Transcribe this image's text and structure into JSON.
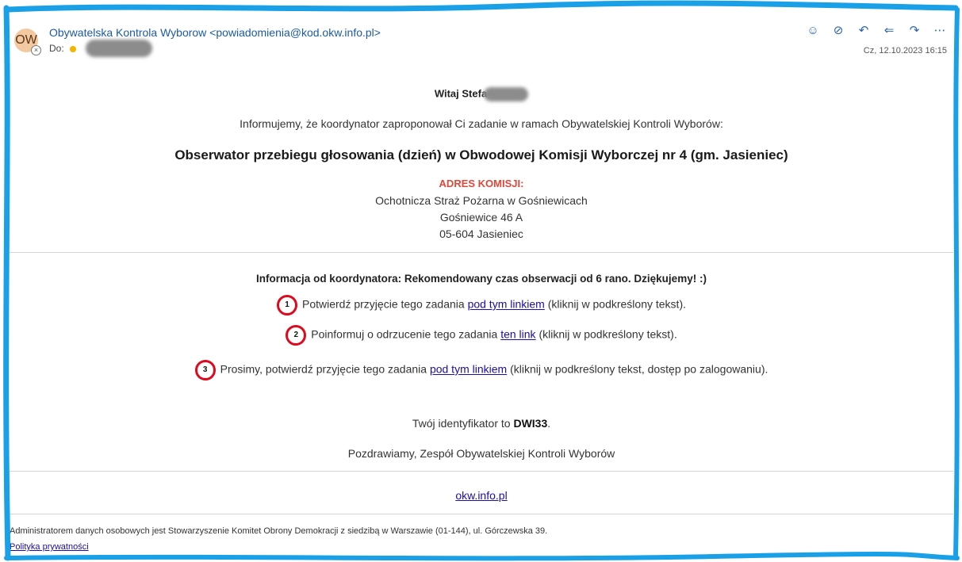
{
  "header": {
    "avatar_initials": "OW",
    "sender": "Obywatelska Kontrola Wyborow <powiadomienia@kod.okw.info.pl>",
    "to_label": "Do:",
    "date": "Cz, 12.10.2023 16:15",
    "toolbar_icons": [
      "emoji-icon",
      "block-icon",
      "reply-icon",
      "reply-all-icon",
      "forward-icon",
      "more-icon"
    ]
  },
  "body": {
    "greeting": "Witaj Stefa",
    "intro": "Informujemy, że koordynator zaproponował Ci zadanie w ramach Obywatelskiej Kontroli Wyborów:",
    "task_title": "Obserwator przebiegu głosowania (dzień) w Obwodowej Komisji Wyborczej nr 4 (gm. Jasieniec)",
    "address_label": "ADRES KOMISJI:",
    "address_lines": [
      "Ochotnicza Straż Pożarna w Gośniewicach",
      "Gośniewice 46 A",
      "05-604 Jasieniec"
    ],
    "coordinator_info": "Informacja od koordynatora: Rekomendowany czas obserwacji od 6 rano. Dziękujemy! :)",
    "actions": [
      {
        "number": "1",
        "before": "Potwierdź przyjęcie tego zadania ",
        "link": "pod tym linkiem",
        "after": " (kliknij w podkreślony tekst)."
      },
      {
        "number": "2",
        "before": "Poinformuj o odrzucenie tego zadania ",
        "link": "ten link",
        "after": " (kliknij w podkreślony tekst)."
      },
      {
        "number": "3",
        "before": "Prosimy, potwierdź przyjęcie tego zadania ",
        "link": "pod tym linkiem",
        "after": " (kliknij w podkreślony tekst, dostęp po zalogowaniu)."
      }
    ],
    "identifier_prefix": "Twój identyfikator to ",
    "identifier": "DWI33",
    "identifier_suffix": ".",
    "regards": "Pozdrawiamy, Zespół Obywatelskiej Kontroli Wyborów",
    "site_link": "okw.info.pl"
  },
  "footer": {
    "admin_text": "Administratorem danych osobowych jest Stowarzyszenie Komitet Obrony Demokracji z siedzibą w Warszawie (01-144), ul. Górczewska 39.",
    "privacy_link": "Polityka prywatności"
  },
  "colors": {
    "frame": "#1aa0e6",
    "link": "#1a0dab",
    "sender": "#1d5aa6",
    "address_label": "#e0473a",
    "marker": "#e0081c"
  }
}
